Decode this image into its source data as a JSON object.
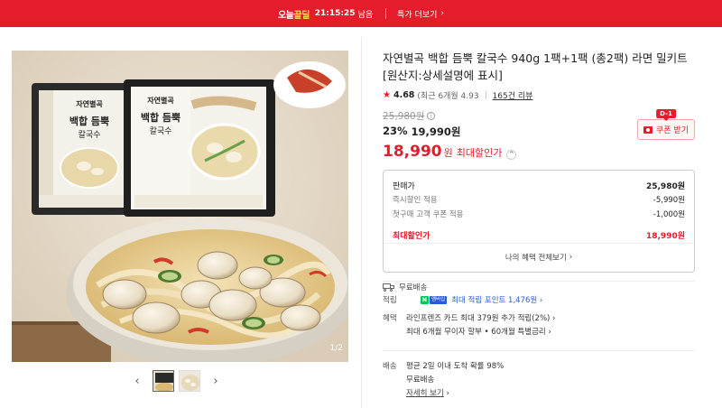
{
  "topbar": {
    "logo_part1": "오늘",
    "logo_part2": "끝딜",
    "time": "21:15:25",
    "time_suffix": "남음",
    "more_label": "특가 더보기",
    "more_icon": "chevron-right-icon"
  },
  "gallery": {
    "counter": "1/2",
    "thumb_count": 2,
    "active_thumb": 1,
    "package_brand": "자연별곡",
    "package_name_line1": "백합 듬뿍",
    "package_name_line2": "칼국수"
  },
  "product": {
    "title": "자연별곡 백합 듬뿍 칼국수 940g 1팩+1팩 (총2팩) 라면 밀키트 [원산지:상세설명에 표시]",
    "rating": "4.68",
    "rating_recent": "(최근 6개월 4.93",
    "review_count": "165건 리뷰",
    "original_price": "25,980원",
    "discount_rate": "23%",
    "discount_price": "19,990원",
    "final_price": "18,990",
    "final_won": "원",
    "final_label": "최대할인가"
  },
  "coupon": {
    "dday": "D-1",
    "label": "쿠폰 받기"
  },
  "breakdown": {
    "rows": [
      {
        "label": "판매가",
        "value": "25,980원"
      },
      {
        "label": "즉시할인 적용",
        "value": "-5,990원"
      },
      {
        "label": "첫구매 고객 쿠폰 적용",
        "value": "-1,000원"
      }
    ],
    "total_label": "최대할인가",
    "total_value": "18,990원",
    "benefits_link": "나의 혜택 전체보기"
  },
  "delivery_badge": "무료배송",
  "details": {
    "points_key": "적립",
    "points_badge_n": "N",
    "points_badge_p": "멤버십",
    "points_text": "최대 적립 포인트",
    "points_value": "1,476원",
    "benefits_key": "혜택",
    "benefits_line1": "라인프렌즈 카드 최대 379원 추가 적립(2%)",
    "benefits_line2": "최대 6개월 무이자 할부 • 60개월 특별금리",
    "shipping_key": "배송",
    "shipping_line1": "평균 2일 이내 도착 확률 98%",
    "shipping_line2": "무료배송",
    "shipping_more": "자세히 보기"
  },
  "colors": {
    "brand_red": "#e51c2c",
    "points_blue": "#2a5bd7",
    "naver_green": "#03c75a"
  }
}
